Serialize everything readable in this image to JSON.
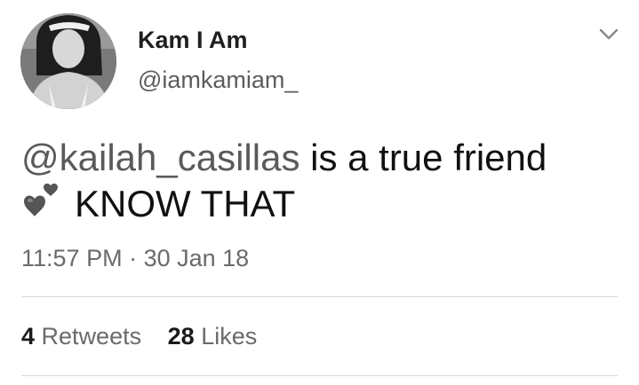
{
  "user": {
    "display_name": "Kam I Am",
    "handle": "@iamkamiam_"
  },
  "tweet": {
    "mention": "@kailah_casillas",
    "text_after_mention": " is a true friend",
    "emoji_icon": "two-hearts-icon",
    "text_line2": "KNOW THAT"
  },
  "meta": {
    "time": "11:57 PM",
    "separator": " · ",
    "date": "30 Jan 18"
  },
  "stats": {
    "retweets_count": "4",
    "retweets_label": "Retweets",
    "likes_count": "28",
    "likes_label": "Likes"
  },
  "icons": {
    "menu": "chevron-down-icon"
  }
}
